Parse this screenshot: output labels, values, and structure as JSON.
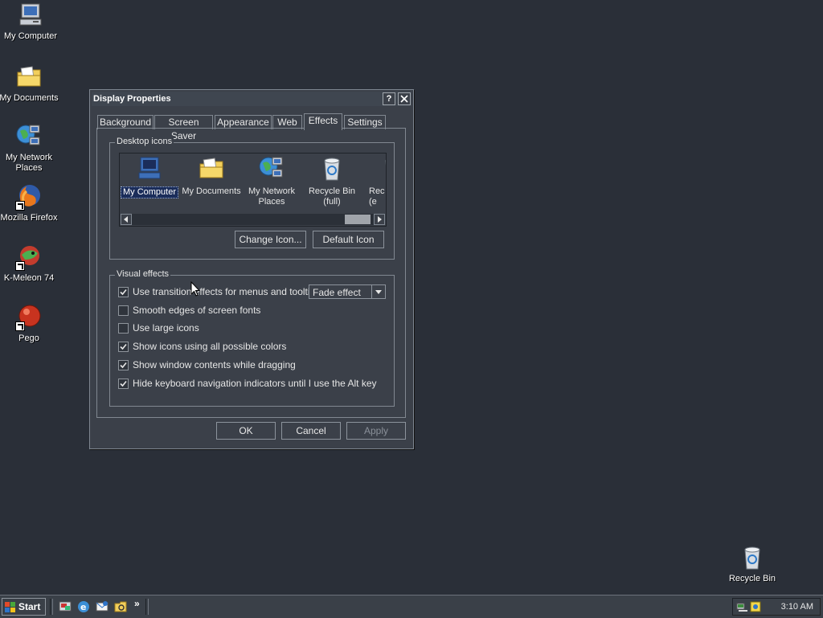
{
  "desktop": {
    "icons": [
      {
        "label": "My Computer",
        "icon": "computer-icon"
      },
      {
        "label": "My Documents",
        "icon": "folder-documents-icon"
      },
      {
        "label": "My Network Places",
        "icon": "network-icon"
      },
      {
        "label": "Mozilla Firefox",
        "icon": "firefox-icon"
      },
      {
        "label": "K-Meleon 74",
        "icon": "kmeleon-icon"
      },
      {
        "label": "Pego",
        "icon": "pego-icon"
      },
      {
        "label": "Recycle Bin",
        "icon": "recycle-bin-icon"
      }
    ]
  },
  "dialog": {
    "title": "Display Properties",
    "help_button": "?",
    "tabs": [
      "Background",
      "Screen Saver",
      "Appearance",
      "Web",
      "Effects",
      "Settings"
    ],
    "active_tab": "Effects",
    "desktop_icons_group": {
      "title": "Desktop icons",
      "items": [
        {
          "label": "My Computer",
          "selected": true
        },
        {
          "label": "My Documents"
        },
        {
          "label": "My Network Places"
        },
        {
          "label": "Recycle Bin (full)"
        },
        {
          "label": "Rec (e"
        }
      ],
      "change_icon_button": "Change Icon...",
      "default_icon_button": "Default Icon"
    },
    "visual_effects_group": {
      "title": "Visual effects",
      "transition_effect_select": "Fade effect",
      "options": [
        {
          "label": "Use transition effects for menus and tooltips",
          "checked": true
        },
        {
          "label": "Smooth edges of screen fonts",
          "checked": false
        },
        {
          "label": "Use large icons",
          "checked": false
        },
        {
          "label": "Show icons using all possible colors",
          "checked": true
        },
        {
          "label": "Show window contents while dragging",
          "checked": true
        },
        {
          "label": "Hide keyboard navigation indicators until I use the Alt key",
          "checked": true
        }
      ]
    },
    "buttons": {
      "ok": "OK",
      "cancel": "Cancel",
      "apply": "Apply"
    }
  },
  "taskbar": {
    "start_label": "Start",
    "quick_launch": [
      "show-desktop-icon",
      "internet-explorer-icon",
      "outlook-express-icon",
      "windows-explorer-icon"
    ],
    "overflow": "»",
    "clock": "3:10 AM"
  },
  "colors": {
    "desktop": "#2a2f38",
    "dialog": "#3b4049",
    "selection": "#1b2d5a"
  }
}
